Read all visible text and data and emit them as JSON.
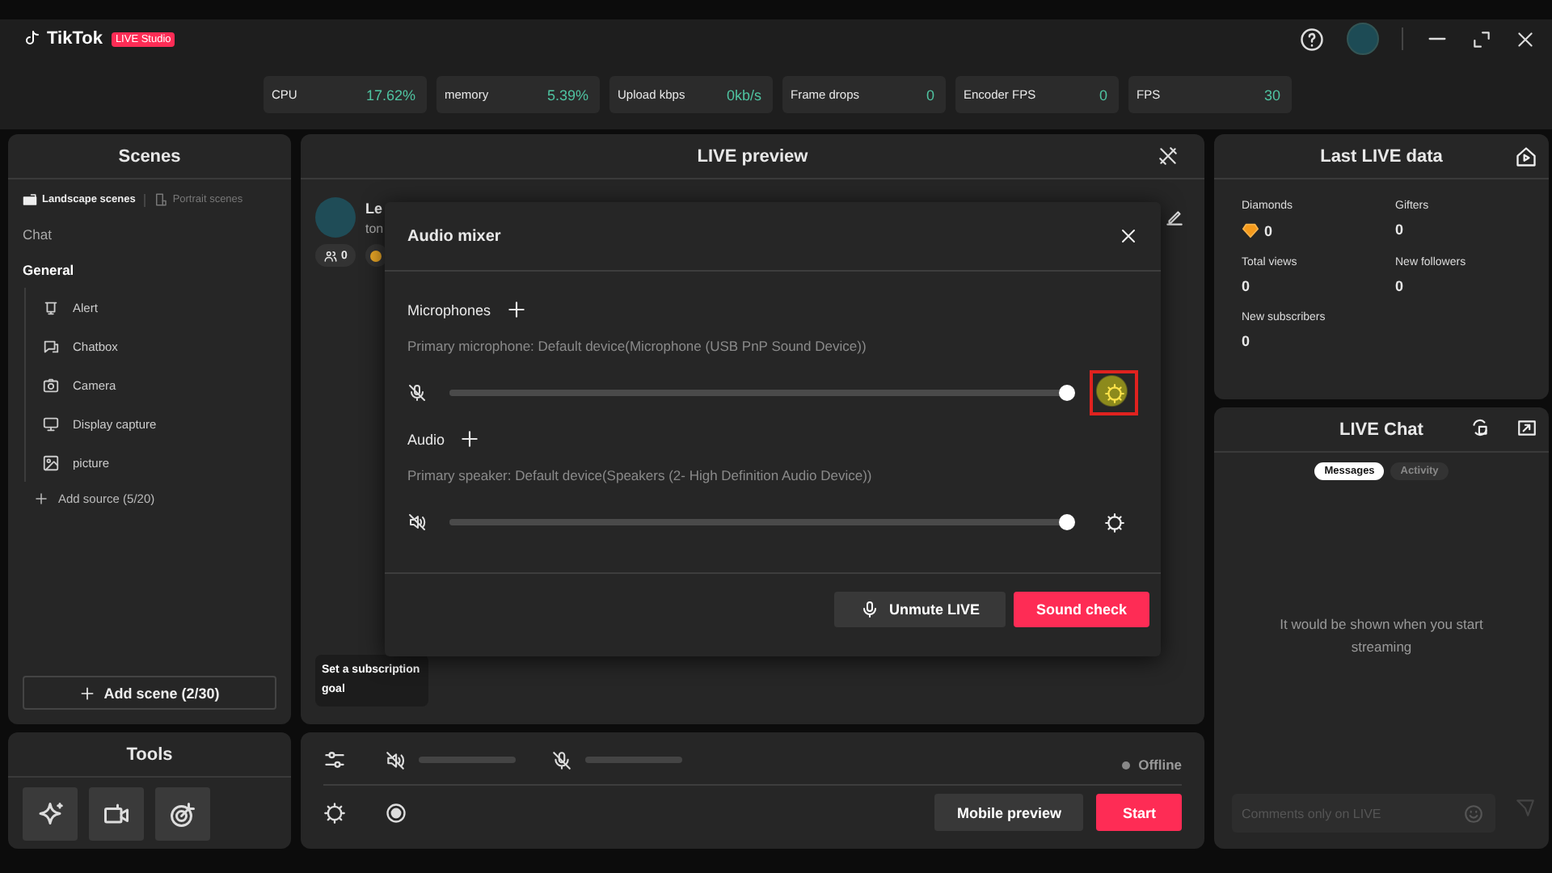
{
  "app": {
    "logo": "TikTok",
    "badge": "LIVE Studio"
  },
  "stats": [
    {
      "label": "CPU",
      "value": "17.62%"
    },
    {
      "label": "memory",
      "value": "5.39%"
    },
    {
      "label": "Upload kbps",
      "value": "0kb/s"
    },
    {
      "label": "Frame drops",
      "value": "0"
    },
    {
      "label": "Encoder FPS",
      "value": "0"
    },
    {
      "label": "FPS",
      "value": "30"
    }
  ],
  "scenes_panel": {
    "title": "Scenes",
    "tabs": [
      {
        "label": "Landscape scenes",
        "selected": true
      },
      {
        "label": "Portrait scenes",
        "selected": false
      }
    ],
    "scenes": [
      {
        "name": "Chat",
        "selected": false
      },
      {
        "name": "General",
        "selected": true,
        "sources": [
          {
            "name": "Alert",
            "kind": "alert"
          },
          {
            "name": "Chatbox",
            "kind": "chatbox"
          },
          {
            "name": "Camera",
            "kind": "camera"
          },
          {
            "name": "Display capture",
            "kind": "display"
          },
          {
            "name": "picture",
            "kind": "picture"
          }
        ]
      }
    ],
    "add_source": "Add source (5/20)",
    "add_scene": "Add scene (2/30)"
  },
  "tools": {
    "title": "Tools",
    "buttons": [
      {
        "kind": "sparkle"
      },
      {
        "kind": "video"
      },
      {
        "kind": "target"
      }
    ]
  },
  "preview": {
    "title": "LIVE preview",
    "profile": {
      "name": "Le",
      "handle": "ton",
      "viewers": "0"
    },
    "goal": "Set a subscription goal"
  },
  "audio_mixer": {
    "title": "Audio mixer",
    "sections": [
      {
        "title": "Microphones",
        "device": "Primary microphone: Default device(Microphone (USB PnP Sound Device))",
        "kind": "microphone",
        "muted": true,
        "level": 1,
        "highlighted": true
      },
      {
        "title": "Audio",
        "device": "Primary speaker: Default device(Speakers (2- High Definition Audio Device))",
        "kind": "speaker",
        "muted": true,
        "level": 1,
        "highlighted": false
      }
    ],
    "buttons": [
      {
        "label": "Unmute LIVE",
        "kind": "secondary"
      },
      {
        "label": "Sound check",
        "kind": "primary"
      }
    ]
  },
  "controls": {
    "sliders": [
      {
        "kind": "speaker",
        "muted": true,
        "level": 0
      },
      {
        "kind": "microphone",
        "muted": true,
        "level": 0
      }
    ],
    "status": "Offline",
    "buttons": [
      {
        "label": "Mobile preview",
        "kind": "secondary"
      },
      {
        "label": "Start",
        "kind": "primary"
      }
    ]
  },
  "last_live": {
    "title": "Last LIVE data",
    "stats": [
      {
        "label": "Diamonds",
        "value": "0",
        "kind": "diamond"
      },
      {
        "label": "Gifters",
        "value": "0",
        "kind": "plain"
      },
      {
        "label": "Total views",
        "value": "0",
        "kind": "plain"
      },
      {
        "label": "New followers",
        "value": "0",
        "kind": "plain"
      },
      {
        "label": "New subscribers",
        "value": "0",
        "kind": "plain"
      }
    ]
  },
  "chat": {
    "title": "LIVE Chat",
    "tabs": [
      {
        "label": "Messages",
        "selected": true
      },
      {
        "label": "Activity",
        "selected": false
      }
    ],
    "empty": "It would be shown when you start streaming",
    "input": {
      "placeholder": "Comments only on LIVE"
    }
  }
}
